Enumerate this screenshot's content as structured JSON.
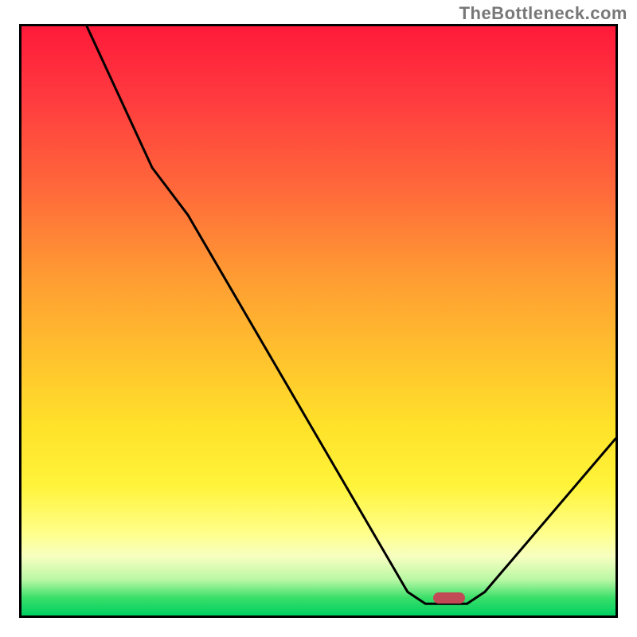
{
  "watermark": "TheBottleneck.com",
  "chart_data": {
    "type": "line",
    "title": "",
    "xlabel": "",
    "ylabel": "",
    "xlim": [
      0,
      100
    ],
    "ylim": [
      0,
      100
    ],
    "series": [
      {
        "name": "curve",
        "points": [
          {
            "x": 11,
            "y": 100
          },
          {
            "x": 22,
            "y": 76
          },
          {
            "x": 28,
            "y": 68
          },
          {
            "x": 65,
            "y": 4
          },
          {
            "x": 68,
            "y": 2
          },
          {
            "x": 75,
            "y": 2
          },
          {
            "x": 78,
            "y": 4
          },
          {
            "x": 100,
            "y": 30
          }
        ]
      }
    ],
    "marker": {
      "x": 72,
      "y": 3,
      "color": "#c24a56"
    },
    "background_gradient": {
      "stops": [
        {
          "stop": 0.0,
          "color": "#ff1a3a"
        },
        {
          "stop": 0.12,
          "color": "#ff3a3f"
        },
        {
          "stop": 0.28,
          "color": "#ff6a3a"
        },
        {
          "stop": 0.42,
          "color": "#ff9a33"
        },
        {
          "stop": 0.55,
          "color": "#ffbf2e"
        },
        {
          "stop": 0.68,
          "color": "#ffe22a"
        },
        {
          "stop": 0.78,
          "color": "#fff43a"
        },
        {
          "stop": 0.86,
          "color": "#ffff8a"
        },
        {
          "stop": 0.9,
          "color": "#f7ffc0"
        },
        {
          "stop": 0.94,
          "color": "#b8f7a4"
        },
        {
          "stop": 0.97,
          "color": "#3adf6a"
        },
        {
          "stop": 1.0,
          "color": "#00d060"
        }
      ]
    }
  }
}
